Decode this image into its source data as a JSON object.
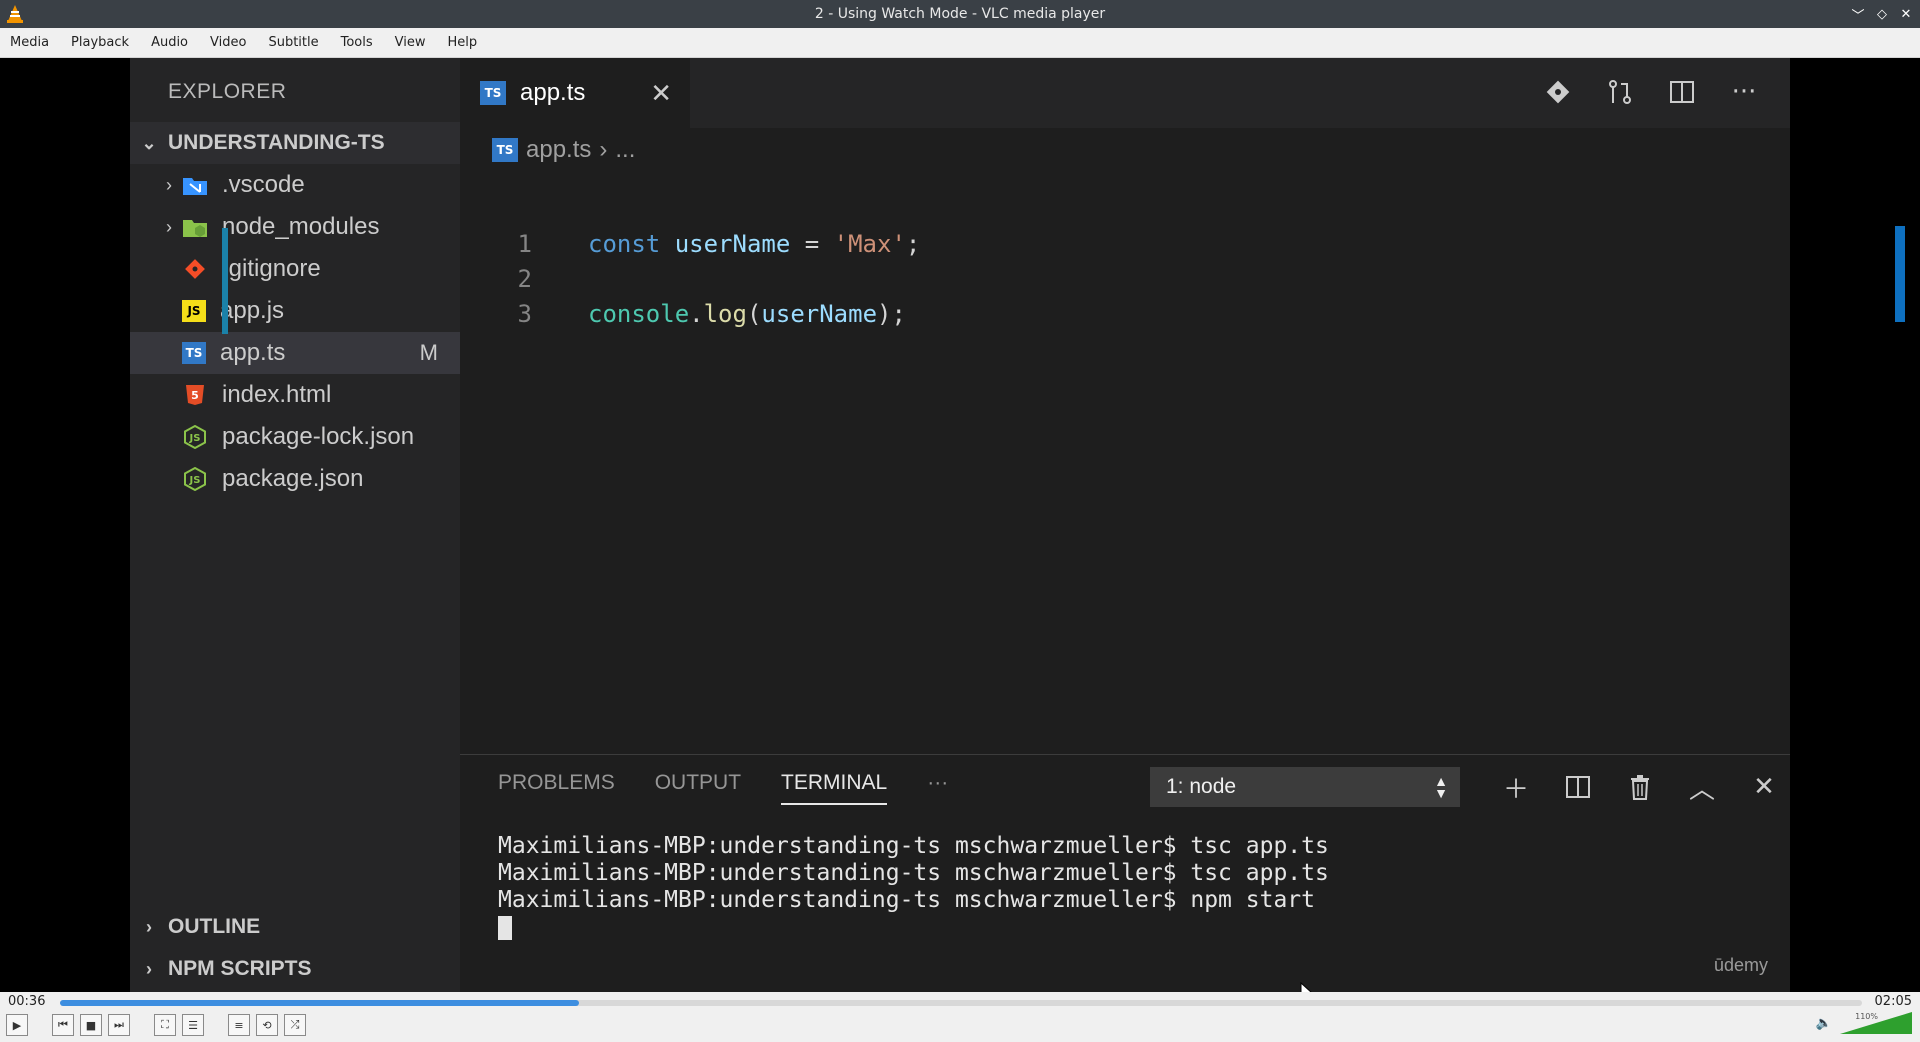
{
  "window": {
    "title": "2 - Using Watch Mode - VLC media player"
  },
  "menu": [
    "Media",
    "Playback",
    "Audio",
    "Video",
    "Subtitle",
    "Tools",
    "View",
    "Help"
  ],
  "explorer": {
    "title": "EXPLORER",
    "project": "UNDERSTANDING-TS",
    "files": [
      {
        "name": ".vscode",
        "type": "folder",
        "icon": "vscode-folder-icon",
        "color": "#3794ff"
      },
      {
        "name": "node_modules",
        "type": "folder",
        "icon": "node-folder-icon",
        "color": "#8bc34a"
      },
      {
        "name": ".gitignore",
        "type": "file",
        "icon": "git-icon",
        "color": "#f44d27"
      },
      {
        "name": "app.js",
        "type": "file",
        "icon": "js-icon",
        "color": "#f5de19"
      },
      {
        "name": "app.ts",
        "type": "file",
        "icon": "ts-icon",
        "color": "#3178c6",
        "badge": "M"
      },
      {
        "name": "index.html",
        "type": "file",
        "icon": "html-icon",
        "color": "#e44d26"
      },
      {
        "name": "package-lock.json",
        "type": "file",
        "icon": "npm-icon",
        "color": "#8bc34a"
      },
      {
        "name": "package.json",
        "type": "file",
        "icon": "npm-icon",
        "color": "#8bc34a"
      }
    ],
    "sections": [
      "OUTLINE",
      "NPM SCRIPTS"
    ]
  },
  "editor": {
    "tab_label": "app.ts",
    "breadcrumb_file": "app.ts",
    "breadcrumb_more": "...",
    "line_numbers": [
      "1",
      "2",
      "3"
    ]
  },
  "panel": {
    "tabs": [
      "PROBLEMS",
      "OUTPUT",
      "TERMINAL"
    ],
    "more": "···",
    "terminal_select": "1: node",
    "terminal_lines": [
      "Maximilians-MBP:understanding-ts mschwarzmueller$ tsc app.ts",
      "Maximilians-MBP:understanding-ts mschwarzmueller$ tsc app.ts",
      "Maximilians-MBP:understanding-ts mschwarzmueller$ npm start"
    ],
    "watermark": "ūdemy"
  },
  "player": {
    "elapsed": "00:36",
    "total": "02:05",
    "progress": 0.288,
    "volume_text": "110%"
  },
  "colors": {
    "accent": "#3d8ee0",
    "ts_blue": "#3178c6"
  }
}
